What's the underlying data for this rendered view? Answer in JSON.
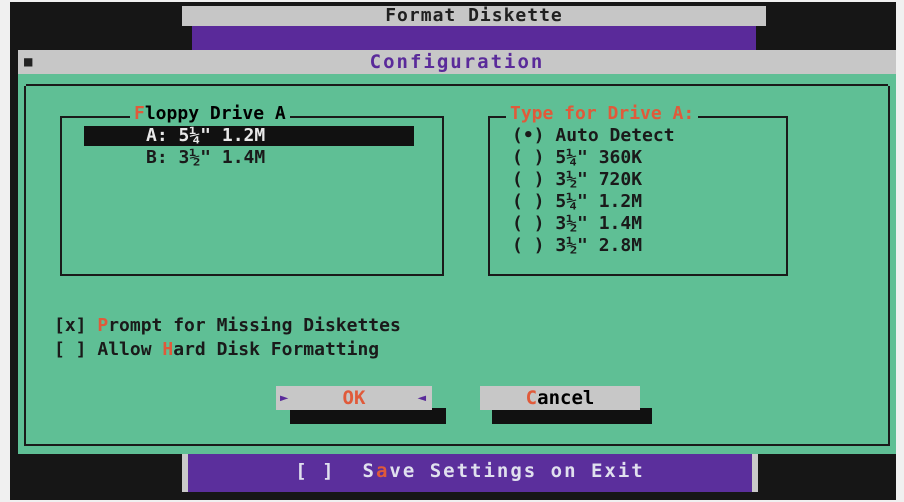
{
  "background_window": {
    "title": "Format Diskette",
    "footer_checkbox": "[ ]",
    "footer_label_pre": "S",
    "footer_label_hot": "a",
    "footer_label_post": "ve Settings on Exit"
  },
  "dialog": {
    "title": "Configuration",
    "close_glyph": "■"
  },
  "floppy_drive_box": {
    "title": "Floppy Drive A",
    "title_hot": "F",
    "title_rest": "loppy Drive A",
    "items": [
      {
        "label": "A: 5¼\" 1.2M",
        "selected": true
      },
      {
        "label": "B: 3½\" 1.4M",
        "selected": false
      }
    ]
  },
  "type_box": {
    "title": "Type for Drive A:",
    "options": [
      {
        "mark": "(•)",
        "label": "Auto Detect",
        "checked": true
      },
      {
        "mark": "( )",
        "label": "5¼\" 360K",
        "checked": false
      },
      {
        "mark": "( )",
        "label": "3½\" 720K",
        "checked": false
      },
      {
        "mark": "( )",
        "label": "5¼\" 1.2M",
        "checked": false
      },
      {
        "mark": "( )",
        "label": "3½\" 1.4M",
        "checked": false
      },
      {
        "mark": "( )",
        "label": "3½\" 2.8M",
        "checked": false
      }
    ]
  },
  "checkboxes": [
    {
      "box": "[x]",
      "hot": "P",
      "rest": "rompt for Missing Diskettes",
      "checked": true
    },
    {
      "box": "[ ]",
      "pre": "Allow ",
      "hot": "H",
      "rest": "ard Disk Formatting",
      "checked": false
    }
  ],
  "buttons": {
    "ok": "OK",
    "ok_left_arrow": "►",
    "ok_right_arrow": "◄",
    "cancel_hot": "C",
    "cancel_rest": "ancel"
  },
  "colors": {
    "dialog_bg": "#5fbf95",
    "title_bar": "#c7c7c7",
    "accent_purple": "#5a2a9a",
    "hotkey": "#e05a3a"
  }
}
